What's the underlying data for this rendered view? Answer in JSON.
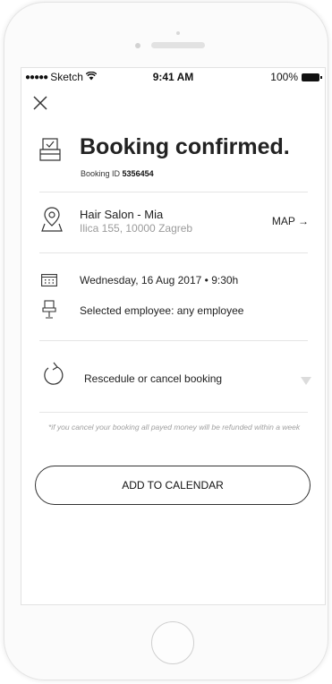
{
  "status_bar": {
    "signal": "●●●●●",
    "carrier": "Sketch",
    "time": "9:41 AM",
    "battery": "100%"
  },
  "header": {
    "title": "Booking confirmed.",
    "booking_id_label": "Booking ID",
    "booking_id": "5356454"
  },
  "salon": {
    "name": "Hair Salon - Mia",
    "address": "Ilica 155, 10000 Zagreb",
    "map_label": "MAP →"
  },
  "appointment": {
    "datetime": "Wednesday, 16 Aug 2017 • 9:30h",
    "employee": "Selected employee: any employee"
  },
  "reschedule": {
    "label": "Rescedule or cancel booking"
  },
  "refund_note": "*if you cancel your booking all payed money will be refunded within a week",
  "actions": {
    "add_to_calendar": "ADD TO CALENDAR"
  },
  "icons": [
    "close-icon",
    "confirm-icon",
    "pin-icon",
    "calendar-icon",
    "chair-icon",
    "refresh-icon",
    "chevron-down-icon",
    "wifi-icon",
    "battery-icon"
  ],
  "colors": {
    "text": "#222222",
    "muted": "#9b9b9b",
    "divider": "#e5e5e5",
    "button_border": "#333333"
  }
}
